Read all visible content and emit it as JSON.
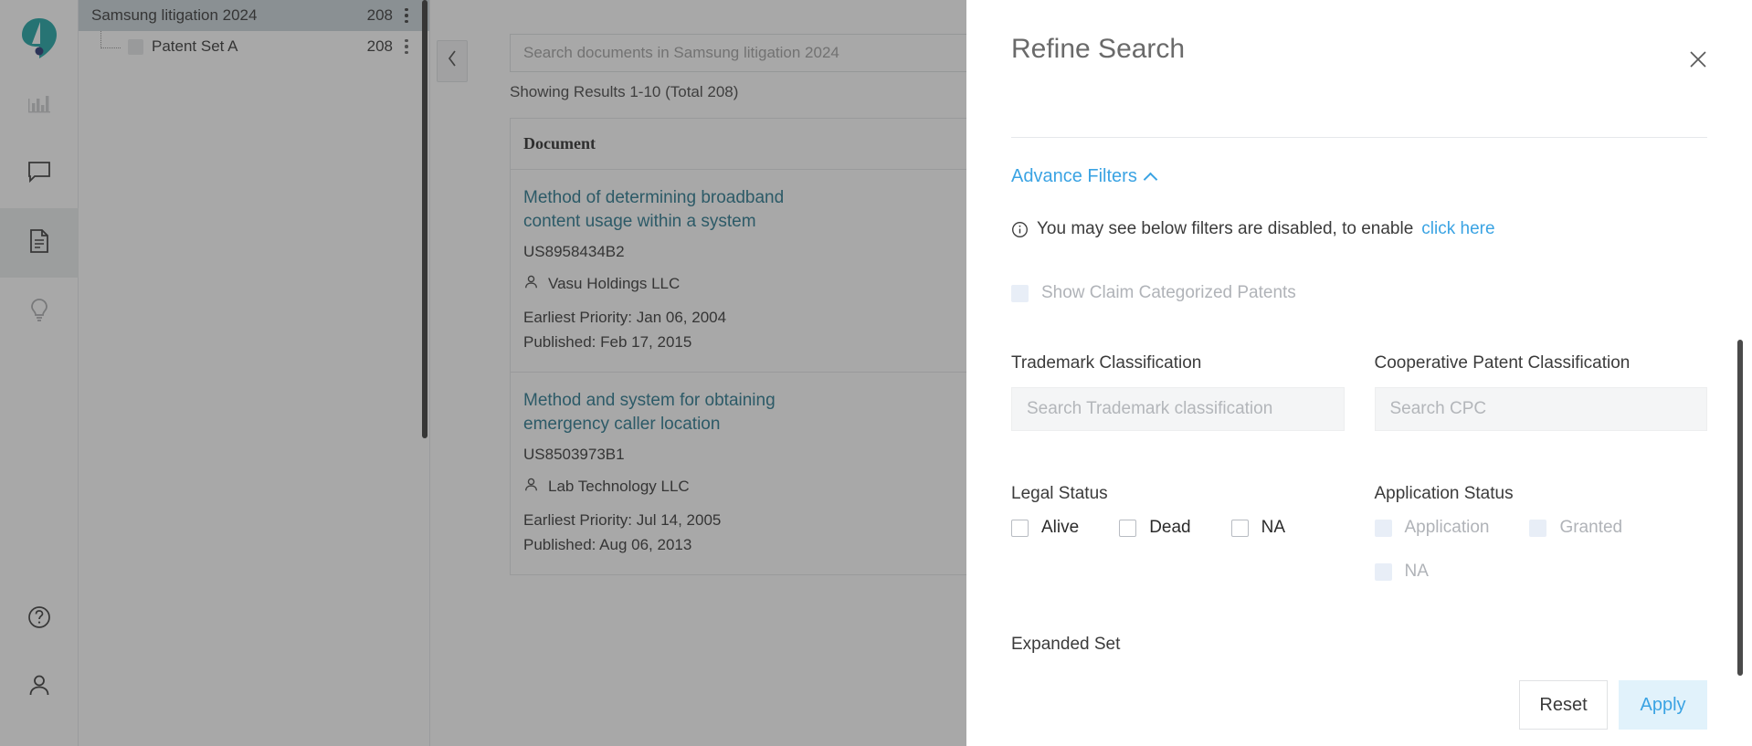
{
  "rail": {
    "logo": "app-logo",
    "items": [
      {
        "name": "analytics",
        "icon": "bar-chart-icon",
        "active": false
      },
      {
        "name": "messages",
        "icon": "chat-bubble-icon",
        "active": false
      },
      {
        "name": "documents",
        "icon": "document-icon",
        "active": true
      },
      {
        "name": "insights",
        "icon": "lightbulb-icon",
        "active": false
      }
    ],
    "bottom": [
      {
        "name": "help",
        "icon": "help-circle-icon"
      },
      {
        "name": "account",
        "icon": "user-icon"
      }
    ]
  },
  "tree": {
    "rows": [
      {
        "label": "Samsung litigation 2024",
        "count": "208",
        "selected": true,
        "child": false
      },
      {
        "label": "Patent Set A",
        "count": "208",
        "selected": false,
        "child": true
      }
    ]
  },
  "collapse": {
    "icon": "chevron-left-icon"
  },
  "search": {
    "placeholder": "Search documents in Samsung litigation 2024",
    "value": ""
  },
  "results": {
    "showing": "Showing Results 1-10 (Total 208)",
    "column_header": "Document",
    "documents": [
      {
        "title": "Method of determining broadband content usage within a system",
        "id": "US8958434B2",
        "assignee": "Vasu Holdings LLC",
        "earliest_priority": "Earliest Priority: Jan 06, 2004",
        "published": "Published: Feb 17, 2015"
      },
      {
        "title": "Method and system for obtaining emergency caller location",
        "id": "US8503973B1",
        "assignee": "Lab Technology LLC",
        "earliest_priority": "Earliest Priority: Jul 14, 2005",
        "published": "Published: Aug 06, 2013"
      }
    ]
  },
  "drawer": {
    "title": "Refine Search",
    "close_icon": "close-icon",
    "advance_filters": {
      "label": "Advance Filters",
      "chevron": "chevron-up-icon"
    },
    "notice": {
      "icon": "info-icon",
      "text": "You may see below filters are disabled, to enable",
      "link": "click here"
    },
    "show_claim_categorized": {
      "label": "Show Claim Categorized Patents",
      "checked": false,
      "disabled": true
    },
    "trademark_classification": {
      "label": "Trademark Classification",
      "placeholder": "Search Trademark classification",
      "value": ""
    },
    "cooperative_patent_classification": {
      "label": "Cooperative Patent Classification",
      "placeholder": "Search CPC",
      "value": ""
    },
    "legal_status": {
      "label": "Legal Status",
      "options": [
        {
          "label": "Alive",
          "checked": false,
          "disabled": false
        },
        {
          "label": "Dead",
          "checked": false,
          "disabled": false
        },
        {
          "label": "NA",
          "checked": false,
          "disabled": false
        }
      ]
    },
    "application_status": {
      "label": "Application Status",
      "options": [
        {
          "label": "Application",
          "checked": false,
          "disabled": true
        },
        {
          "label": "Granted",
          "checked": false,
          "disabled": true
        },
        {
          "label": "NA",
          "checked": false,
          "disabled": true
        }
      ]
    },
    "expanded_set": {
      "label": "Expanded Set"
    },
    "footer": {
      "reset_label": "Reset",
      "apply_label": "Apply"
    }
  },
  "colors": {
    "accent_blue": "#3aa3e3",
    "link_teal": "#1a6f87",
    "logo_teal": "#0f9d9d",
    "logo_navy": "#1b2a6b",
    "tree_selected": "#c7d3d9",
    "apply_bg": "#e1f2fb"
  }
}
